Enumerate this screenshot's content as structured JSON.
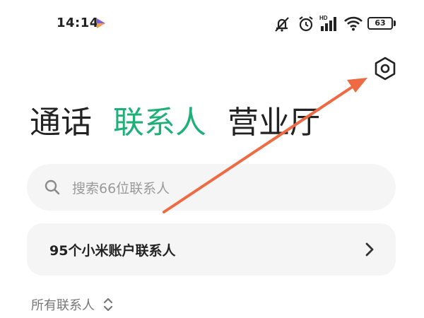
{
  "status_bar": {
    "time": "14:14",
    "battery_level": "63",
    "icons": [
      "media-play-icon",
      "mute-icon",
      "alarm-icon",
      "hd-signal-icon",
      "wifi-icon",
      "battery-icon"
    ]
  },
  "header": {
    "settings_icon": "hexagon-settings-icon"
  },
  "tabs": [
    {
      "label": "通话",
      "active": false
    },
    {
      "label": "联系人",
      "active": true
    },
    {
      "label": "营业厅",
      "active": false
    }
  ],
  "search": {
    "placeholder": "搜索66位联系人",
    "value": ""
  },
  "account_card": {
    "label": "95个小米账户联系人",
    "icon": "chevron-right-icon"
  },
  "filter": {
    "label": "所有联系人",
    "icon": "sort-toggle-icon"
  },
  "colors": {
    "accent": "#1fb07a",
    "annotation": "#ee6a43",
    "card_bg": "#f5f5f5"
  }
}
